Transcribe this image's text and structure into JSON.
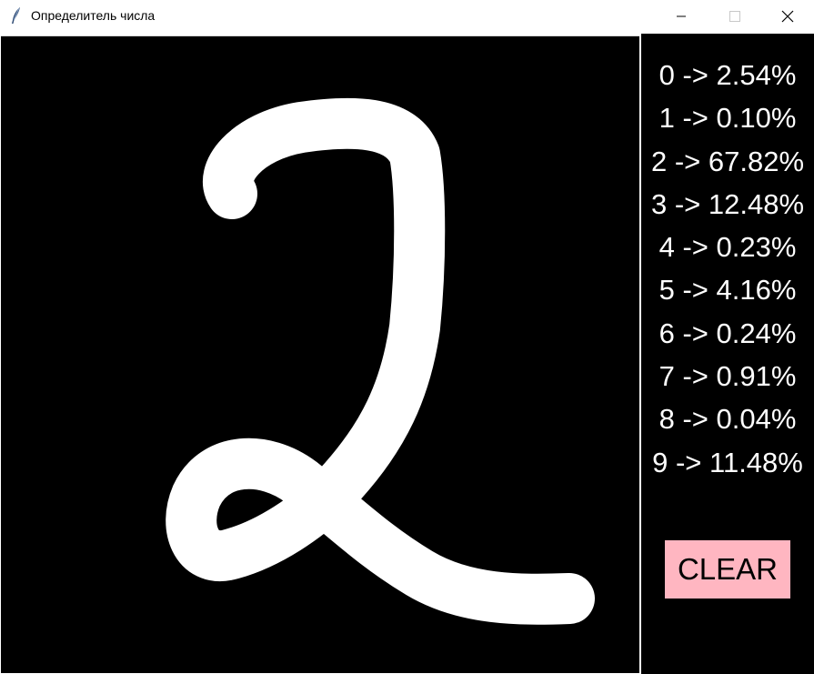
{
  "window": {
    "title": "Определитель числа",
    "icon": "feather-icon",
    "controls": [
      "minimize-icon",
      "maximize-icon",
      "close-icon"
    ]
  },
  "canvas": {
    "background": "#000000",
    "stroke_color": "#ffffff",
    "drawn_digit": "2"
  },
  "predictions": [
    {
      "label": "0 -> 2.54%"
    },
    {
      "label": "1 -> 0.10%"
    },
    {
      "label": "2 -> 67.82%"
    },
    {
      "label": "3 -> 12.48%"
    },
    {
      "label": "4 -> 0.23%"
    },
    {
      "label": "5 -> 4.16%"
    },
    {
      "label": "6 -> 0.24%"
    },
    {
      "label": "7 -> 0.91%"
    },
    {
      "label": "8 -> 0.04%"
    },
    {
      "label": "9 -> 11.48%"
    }
  ],
  "clear_button": {
    "label": "CLEAR",
    "background": "#ffb6c1"
  }
}
